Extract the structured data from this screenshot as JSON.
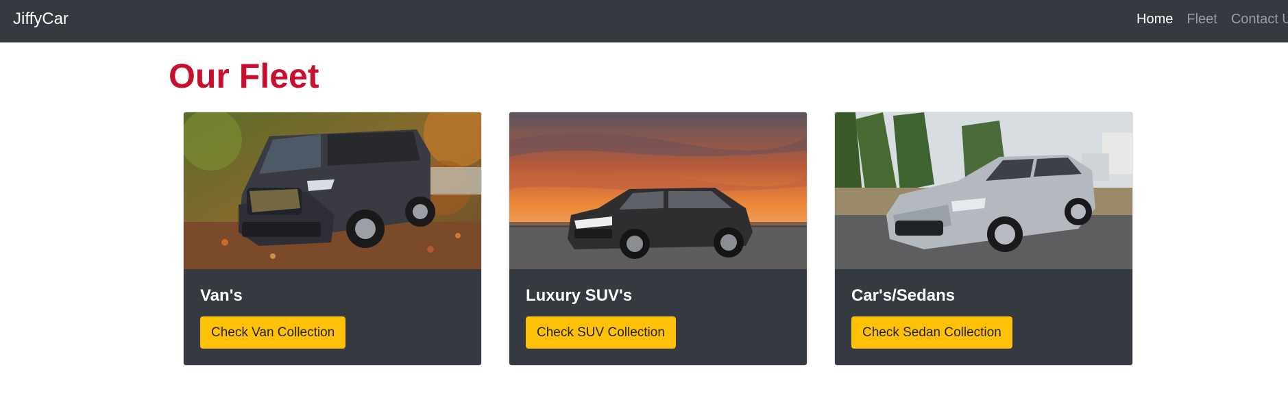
{
  "navbar": {
    "brand": "JiffyCar",
    "links": [
      {
        "label": "Home",
        "active": true
      },
      {
        "label": "Fleet",
        "active": false
      },
      {
        "label": "Contact Us",
        "active": false
      }
    ]
  },
  "page": {
    "title": "Our Fleet"
  },
  "cards": [
    {
      "title": "Van's",
      "button": "Check Van Collection",
      "image_alt": "Dark grey passenger van in autumn forest"
    },
    {
      "title": "Luxury SUV's",
      "button": "Check SUV Collection",
      "image_alt": "Dark SUV at sunset"
    },
    {
      "title": "Car's/Sedans",
      "button": "Check Sedan Collection",
      "image_alt": "Silver sedan on suburban street"
    }
  ],
  "colors": {
    "navbar_bg": "#343a40",
    "title_red": "#c8102e",
    "button_yellow": "#ffc107",
    "card_bg": "#343a40"
  }
}
